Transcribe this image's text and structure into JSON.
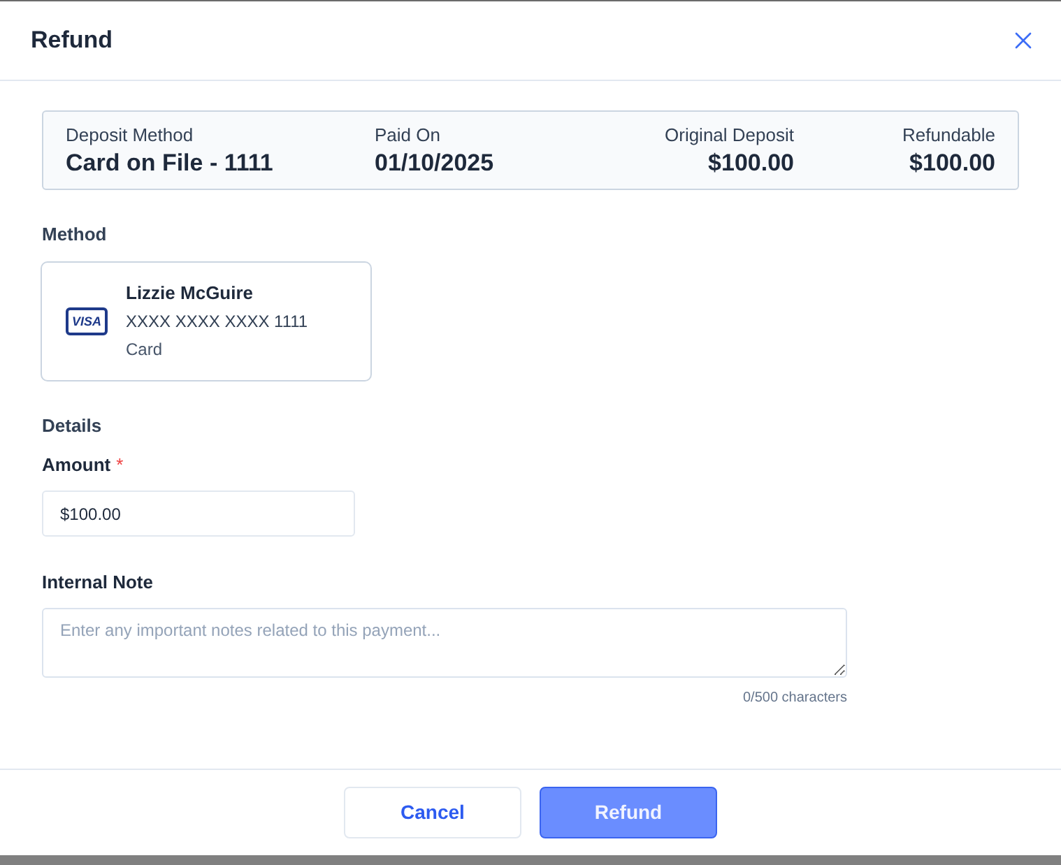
{
  "dialog": {
    "title": "Refund"
  },
  "summary": [
    {
      "label": "Deposit Method",
      "value": "Card on File - 1111"
    },
    {
      "label": "Paid On",
      "value": "01/10/2025"
    },
    {
      "label": "Original Deposit",
      "value": "$100.00"
    },
    {
      "label": "Refundable",
      "value": "$100.00"
    }
  ],
  "method": {
    "label": "Method",
    "card": {
      "brand": "VISA",
      "holder": "Lizzie McGuire",
      "number": "XXXX XXXX XXXX 1111",
      "type": "Card"
    }
  },
  "details": {
    "label": "Details",
    "amount": {
      "label": "Amount",
      "marker": "*",
      "value": "$100.00"
    },
    "note": {
      "label": "Internal Note",
      "placeholder": "Enter any important notes related to this payment...",
      "counter": "0/500 characters"
    }
  },
  "buttons": [
    {
      "label": "Cancel",
      "kind": "secondary"
    },
    {
      "label": "Refund",
      "kind": "primary"
    }
  ]
}
